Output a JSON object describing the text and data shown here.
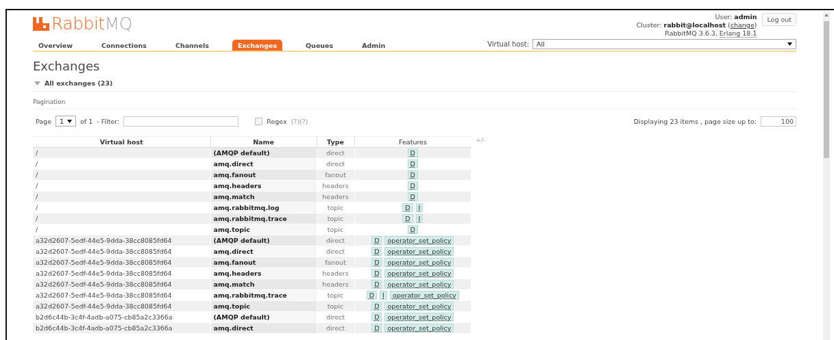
{
  "logo": {
    "part_1": "Rabbit",
    "part_2": "MQ"
  },
  "user": {
    "text": "User: **admin**",
    "logout": "Log out"
  },
  "cluster": {
    "prefix": "Cluster: **rabbit@localhost** (",
    "link": "change",
    "suffix": ")"
  },
  "version": {
    "text": "RabbitMQ 3.6.3, ",
    "erlang": "Erlang 18.1"
  },
  "tabs": [
    {
      "label": "Overview",
      "selected": false
    },
    {
      "label": "Connections",
      "selected": false
    },
    {
      "label": "Channels",
      "selected": false
    },
    {
      "label": "Exchanges",
      "selected": true
    },
    {
      "label": "Queues",
      "selected": false
    },
    {
      "label": "Admin",
      "selected": false
    }
  ],
  "virtual_host": {
    "label": "Virtual host:",
    "value": "All"
  },
  "heading": "Exchanges",
  "section": {
    "title": "All exchanges (23)",
    "expanded": true
  },
  "pagination": {
    "label": "Pagination",
    "page_label": "Page",
    "page": "1",
    "of": "of 1",
    "filter_label": "- Filter:",
    "regex": {
      "label": "Regex",
      "checked": false
    },
    "help": "(?)(?)",
    "displaying": "Displaying 23 items , page size up to:",
    "page_size": "100"
  },
  "table": {
    "columns": [
      "Virtual host",
      "Name",
      "Type",
      "Features"
    ],
    "toggle": "+/-",
    "rows": [
      {
        "vhost": "/",
        "name": "(AMQP default)",
        "type": "direct",
        "features": [
          "D"
        ]
      },
      {
        "vhost": "/",
        "name": "amq.direct",
        "type": "direct",
        "features": [
          "D"
        ]
      },
      {
        "vhost": "/",
        "name": "amq.fanout",
        "type": "fanout",
        "features": [
          "D"
        ]
      },
      {
        "vhost": "/",
        "name": "amq.headers",
        "type": "headers",
        "features": [
          "D"
        ]
      },
      {
        "vhost": "/",
        "name": "amq.match",
        "type": "headers",
        "features": [
          "D"
        ]
      },
      {
        "vhost": "/",
        "name": "amq.rabbitmq.log",
        "type": "topic",
        "features": [
          "D",
          "I"
        ]
      },
      {
        "vhost": "/",
        "name": "amq.rabbitmq.trace",
        "type": "topic",
        "features": [
          "D",
          "I"
        ]
      },
      {
        "vhost": "/",
        "name": "amq.topic",
        "type": "topic",
        "features": [
          "D"
        ]
      },
      {
        "vhost": "a32d2607-5edf-44e5-9dda-38cc8085fd64",
        "name": "(AMQP default)",
        "type": "direct",
        "features": [
          "D",
          "operator_set_policy"
        ]
      },
      {
        "vhost": "a32d2607-5edf-44e5-9dda-38cc8085fd64",
        "name": "amq.direct",
        "type": "direct",
        "features": [
          "D",
          "operator_set_policy"
        ]
      },
      {
        "vhost": "a32d2607-5edf-44e5-9dda-38cc8085fd64",
        "name": "amq.fanout",
        "type": "fanout",
        "features": [
          "D",
          "operator_set_policy"
        ]
      },
      {
        "vhost": "a32d2607-5edf-44e5-9dda-38cc8085fd64",
        "name": "amq.headers",
        "type": "headers",
        "features": [
          "D",
          "operator_set_policy"
        ]
      },
      {
        "vhost": "a32d2607-5edf-44e5-9dda-38cc8085fd64",
        "name": "amq.match",
        "type": "headers",
        "features": [
          "D",
          "operator_set_policy"
        ]
      },
      {
        "vhost": "a32d2607-5edf-44e5-9dda-38cc8085fd64",
        "name": "amq.rabbitmq.trace",
        "type": "topic",
        "features": [
          "D",
          "I",
          "operator_set_policy"
        ]
      },
      {
        "vhost": "a32d2607-5edf-44e5-9dda-38cc8085fd64",
        "name": "amq.topic",
        "type": "topic",
        "features": [
          "D",
          "operator_set_policy"
        ]
      },
      {
        "vhost": "b2d6c44b-3c4f-4adb-a075-cb85a2c3366a",
        "name": "(AMQP default)",
        "type": "direct",
        "features": [
          "D",
          "operator_set_policy"
        ]
      },
      {
        "vhost": "b2d6c44b-3c4f-4adb-a075-cb85a2c3366a",
        "name": "amq.direct",
        "type": "direct",
        "features": [
          "D",
          "operator_set_policy"
        ]
      }
    ]
  }
}
